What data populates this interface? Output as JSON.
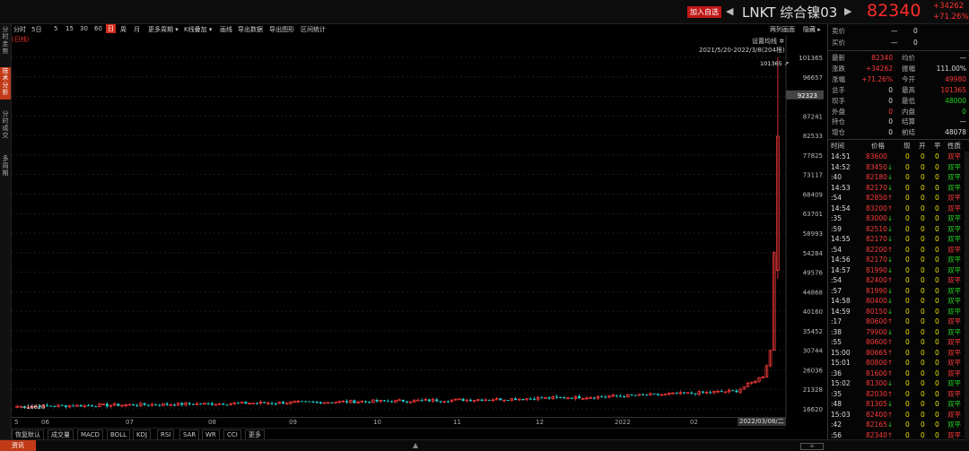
{
  "header": {
    "add_watch": "加入自选",
    "symbol": "LNKT",
    "name": "综合镍03",
    "price": "82340",
    "change": "+34262",
    "change_pct": "+71.26%"
  },
  "left_tabs": [
    "分时走势",
    "技术分析",
    "分时成交",
    "多周期"
  ],
  "toolbar": {
    "items": [
      "分时",
      "5日",
      "5",
      "15",
      "30",
      "60",
      "日",
      "周",
      "月",
      "更多周期",
      "K线叠加",
      "画线",
      "导出数据",
      "导出图形",
      "区间统计"
    ],
    "active": "日",
    "right": [
      "两列画面",
      "隐藏"
    ]
  },
  "chart_overlay": {
    "period_tag": "(日线)",
    "set_ma": "设置均线",
    "range": "2021/5/20-2022/3/8(204根)",
    "high_label": "101365",
    "low_label": "16620",
    "current_label": "92323"
  },
  "y_axis_labels": [
    "101365",
    "96657",
    "91949",
    "87241",
    "82533",
    "77825",
    "73117",
    "68409",
    "63701",
    "58993",
    "54284",
    "49576",
    "44868",
    "40160",
    "35452",
    "30744",
    "26036",
    "21328",
    "16620"
  ],
  "x_axis_labels": [
    "5",
    "06",
    "07",
    "08",
    "09",
    "10",
    "11",
    "12",
    "2022",
    "02"
  ],
  "x_selected": "2022/03/08/二",
  "indicators": [
    "恢复默认",
    "成交量",
    "MACD",
    "BOLL",
    "KDJ",
    "RSI",
    "SAR",
    "WR",
    "CCI",
    "更多"
  ],
  "bottom_tab": "资讯",
  "quote": {
    "sell": {
      "label": "卖价",
      "dash": "—",
      "val": "0"
    },
    "buy": {
      "label": "买价",
      "dash": "—",
      "val": "0"
    },
    "rows": [
      [
        {
          "l": "最新",
          "v": "82340",
          "c": "red"
        },
        {
          "l": "均价",
          "v": "—",
          "c": "white"
        }
      ],
      [
        {
          "l": "涨跌",
          "v": "+34262",
          "c": "red"
        },
        {
          "l": "振幅",
          "v": "111.00%",
          "c": "white"
        }
      ],
      [
        {
          "l": "涨幅",
          "v": "+71.26%",
          "c": "red"
        },
        {
          "l": "今开",
          "v": "49980",
          "c": "red"
        }
      ],
      [
        {
          "l": "总手",
          "v": "0",
          "c": "white"
        },
        {
          "l": "最高",
          "v": "101365",
          "c": "red"
        }
      ],
      [
        {
          "l": "现手",
          "v": "0",
          "c": "white"
        },
        {
          "l": "最低",
          "v": "48000",
          "c": "green"
        }
      ],
      [
        {
          "l": "外盘",
          "v": "0",
          "c": "red"
        },
        {
          "l": "内盘",
          "v": "0",
          "c": "green"
        }
      ],
      [
        {
          "l": "持仓",
          "v": "0",
          "c": "white"
        },
        {
          "l": "结算",
          "v": "—",
          "c": "white"
        }
      ],
      [
        {
          "l": "增仓",
          "v": "0",
          "c": "white"
        },
        {
          "l": "前结",
          "v": "48078",
          "c": "white"
        }
      ]
    ]
  },
  "ticks_header": [
    "时间",
    "价格",
    "现",
    "开",
    "平",
    "性质"
  ],
  "ticks": [
    {
      "t": "14:51",
      "p": "83600",
      "a": "",
      "x": "0",
      "o": "0",
      "f": "0",
      "k": "双平",
      "kc": "red",
      "pc": "red"
    },
    {
      "t": "14:52",
      "p": "83450",
      "a": "↓",
      "x": "0",
      "o": "0",
      "f": "0",
      "k": "双平",
      "kc": "green",
      "pc": "red"
    },
    {
      "t": ":40",
      "p": "82180",
      "a": "↓",
      "x": "0",
      "o": "0",
      "f": "0",
      "k": "双平",
      "kc": "green",
      "pc": "red"
    },
    {
      "t": "14:53",
      "p": "82170",
      "a": "↓",
      "x": "0",
      "o": "0",
      "f": "0",
      "k": "双平",
      "kc": "green",
      "pc": "red"
    },
    {
      "t": ":54",
      "p": "82850",
      "a": "↑",
      "x": "0",
      "o": "0",
      "f": "0",
      "k": "双平",
      "kc": "red",
      "pc": "red"
    },
    {
      "t": "14:54",
      "p": "83200",
      "a": "↑",
      "x": "0",
      "o": "0",
      "f": "0",
      "k": "双平",
      "kc": "red",
      "pc": "red"
    },
    {
      "t": ":35",
      "p": "83000",
      "a": "↓",
      "x": "0",
      "o": "0",
      "f": "0",
      "k": "双平",
      "kc": "green",
      "pc": "red"
    },
    {
      "t": ":59",
      "p": "82510",
      "a": "↓",
      "x": "0",
      "o": "0",
      "f": "0",
      "k": "双平",
      "kc": "green",
      "pc": "red"
    },
    {
      "t": "14:55",
      "p": "82170",
      "a": "↓",
      "x": "0",
      "o": "0",
      "f": "0",
      "k": "双平",
      "kc": "green",
      "pc": "red"
    },
    {
      "t": ":54",
      "p": "82200",
      "a": "↑",
      "x": "0",
      "o": "0",
      "f": "0",
      "k": "双平",
      "kc": "red",
      "pc": "red"
    },
    {
      "t": "14:56",
      "p": "82170",
      "a": "↓",
      "x": "0",
      "o": "0",
      "f": "0",
      "k": "双平",
      "kc": "green",
      "pc": "red"
    },
    {
      "t": "14:57",
      "p": "81990",
      "a": "↓",
      "x": "0",
      "o": "0",
      "f": "0",
      "k": "双平",
      "kc": "green",
      "pc": "red"
    },
    {
      "t": ":54",
      "p": "82400",
      "a": "↑",
      "x": "0",
      "o": "0",
      "f": "0",
      "k": "双平",
      "kc": "red",
      "pc": "red"
    },
    {
      "t": ":57",
      "p": "81990",
      "a": "↓",
      "x": "0",
      "o": "0",
      "f": "0",
      "k": "双平",
      "kc": "green",
      "pc": "red"
    },
    {
      "t": "14:58",
      "p": "80400",
      "a": "↓",
      "x": "0",
      "o": "0",
      "f": "0",
      "k": "双平",
      "kc": "green",
      "pc": "red"
    },
    {
      "t": "14:59",
      "p": "80150",
      "a": "↓",
      "x": "0",
      "o": "0",
      "f": "0",
      "k": "双平",
      "kc": "green",
      "pc": "red"
    },
    {
      "t": ":17",
      "p": "80600",
      "a": "↑",
      "x": "0",
      "o": "0",
      "f": "0",
      "k": "双平",
      "kc": "red",
      "pc": "red"
    },
    {
      "t": ":38",
      "p": "79900",
      "a": "↓",
      "x": "0",
      "o": "0",
      "f": "0",
      "k": "双平",
      "kc": "green",
      "pc": "red"
    },
    {
      "t": ":55",
      "p": "80600",
      "a": "↑",
      "x": "0",
      "o": "0",
      "f": "0",
      "k": "双平",
      "kc": "red",
      "pc": "red"
    },
    {
      "t": "15:00",
      "p": "80665",
      "a": "↑",
      "x": "0",
      "o": "0",
      "f": "0",
      "k": "双平",
      "kc": "red",
      "pc": "red"
    },
    {
      "t": "15:01",
      "p": "80800",
      "a": "↑",
      "x": "0",
      "o": "0",
      "f": "0",
      "k": "双平",
      "kc": "red",
      "pc": "red"
    },
    {
      "t": ":36",
      "p": "81600",
      "a": "↑",
      "x": "0",
      "o": "0",
      "f": "0",
      "k": "双平",
      "kc": "red",
      "pc": "red"
    },
    {
      "t": "15:02",
      "p": "81300",
      "a": "↓",
      "x": "0",
      "o": "0",
      "f": "0",
      "k": "双平",
      "kc": "green",
      "pc": "red"
    },
    {
      "t": ":35",
      "p": "82030",
      "a": "↑",
      "x": "0",
      "o": "0",
      "f": "0",
      "k": "双平",
      "kc": "red",
      "pc": "red"
    },
    {
      "t": ":48",
      "p": "81305",
      "a": "↓",
      "x": "0",
      "o": "0",
      "f": "0",
      "k": "双平",
      "kc": "green",
      "pc": "red"
    },
    {
      "t": "15:03",
      "p": "82400",
      "a": "↑",
      "x": "0",
      "o": "0",
      "f": "0",
      "k": "双平",
      "kc": "red",
      "pc": "red"
    },
    {
      "t": ":42",
      "p": "82165",
      "a": "↓",
      "x": "0",
      "o": "0",
      "f": "0",
      "k": "双平",
      "kc": "green",
      "pc": "red"
    },
    {
      "t": ":56",
      "p": "82340",
      "a": "↑",
      "x": "0",
      "o": "0",
      "f": "0",
      "k": "双平",
      "kc": "red",
      "pc": "red"
    }
  ],
  "colors": {
    "up": "#ff3b3b",
    "down": "#22d4d4",
    "bg": "#000000",
    "accent": "#c13a17"
  },
  "chart_data": {
    "type": "candlestick",
    "ylim": [
      16620,
      101365
    ],
    "last_values": [
      {
        "date": "2022/03/04",
        "close": 30744
      },
      {
        "date": "2022/03/07",
        "close": 54284
      },
      {
        "date": "2022/03/08",
        "open": 49980,
        "high": 101365,
        "low": 48000,
        "close": 82340
      }
    ]
  }
}
